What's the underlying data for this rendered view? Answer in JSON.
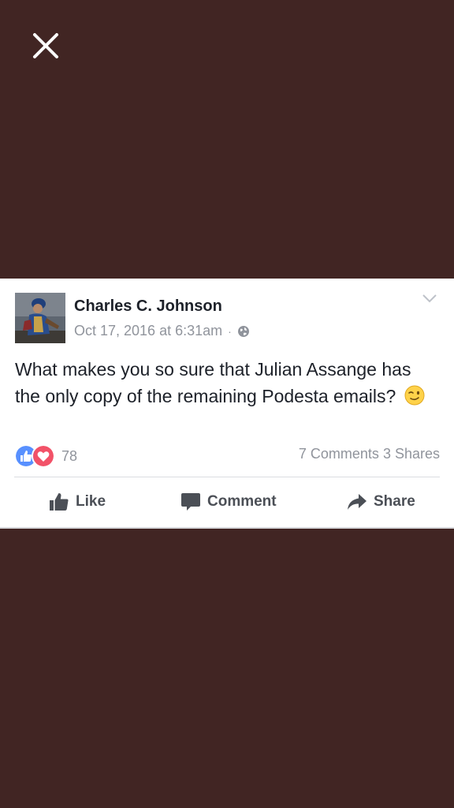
{
  "post": {
    "author": "Charles C. Johnson",
    "timestamp": "Oct 17, 2016 at 6:31am",
    "separator": "·",
    "privacy_icon": "globe-icon",
    "text": "What makes you so sure that Julian Assange has the only copy of the remaining Podesta emails?",
    "emoji": "wink-emoji"
  },
  "reactions": {
    "icons": [
      "like-icon",
      "love-icon"
    ],
    "count": "78",
    "comments": "7 Comments",
    "shares": "3 Shares"
  },
  "actions": {
    "like": "Like",
    "comment": "Comment",
    "share": "Share"
  },
  "colors": {
    "backdrop": "#412523",
    "like_blue": "#5890ff",
    "love_red": "#f25268",
    "action_gray": "#4b4f56",
    "meta_gray": "#90949c"
  }
}
